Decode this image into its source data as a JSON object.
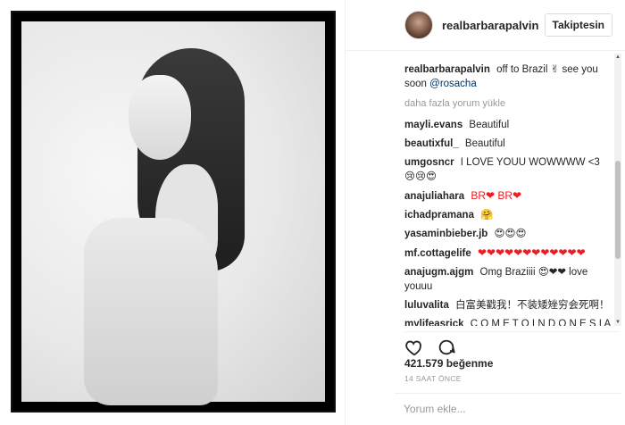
{
  "post": {
    "username": "realbarbarapalvin",
    "follow_label": "Takiptesin",
    "caption_user": "realbarbarapalvin",
    "caption_text": "off to Brazil",
    "caption_emoji": "✌",
    "caption_after": "see you soon",
    "caption_mention": "@rosacha",
    "load_more": "daha fazla yorum yükle",
    "likes": "421.579 beğenme",
    "time": "14 SAAT ÖNCE",
    "comment_placeholder": "Yorum ekle..."
  },
  "comments": [
    {
      "user": "mayli.evans",
      "text": "Beautiful"
    },
    {
      "user": "beautixful_",
      "text": "Beautiful"
    },
    {
      "user": "umgosncr",
      "text": "I LOVE YOUU WOWWWW <3",
      "emojis": "😢😢😍"
    },
    {
      "user": "anajuliahara",
      "text": "BR❤ BR❤"
    },
    {
      "user": "ichadpramana",
      "text": "🤗"
    },
    {
      "user": "yasaminbieber.jb",
      "text": "😍😍😍"
    },
    {
      "user": "mf.cottagelife",
      "text": "❤❤❤❤❤❤❤❤❤❤❤❤"
    },
    {
      "user": "anajugm.ajgm",
      "text": "Omg Braziiii 😍❤❤ love youuu"
    },
    {
      "user": "luluvalita",
      "text": "白富美戳我！不装矮矬穷会死啊！"
    },
    {
      "user": "mylifeasrick",
      "text": "C O M E T O I N D O N E S I A"
    }
  ],
  "colors": {
    "accent_link": "#003569",
    "heart": "#ed1c24",
    "muted": "#999999"
  },
  "icons": {
    "like": "heart-outline-icon",
    "comment": "comment-bubble-icon"
  }
}
